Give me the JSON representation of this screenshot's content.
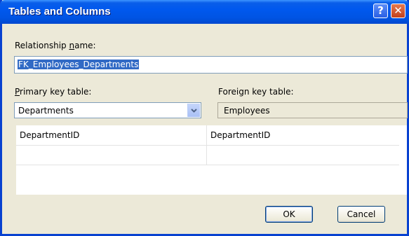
{
  "window": {
    "title": "Tables and Columns",
    "help_glyph": "?",
    "close_glyph": "✕"
  },
  "relationship": {
    "label_pre": "Relationship ",
    "label_mnemonic": "n",
    "label_post": "ame:",
    "value": "FK_Employees_Departments"
  },
  "primary": {
    "label_mnemonic": "P",
    "label_post": "rimary key table:",
    "selected": "Departments"
  },
  "foreign": {
    "label": "Foreign key table:",
    "value": "Employees"
  },
  "columns": {
    "rows": [
      {
        "primary": "DepartmentID",
        "foreign": "DepartmentID"
      },
      {
        "primary": "",
        "foreign": ""
      }
    ]
  },
  "buttons": {
    "ok": "OK",
    "cancel": "Cancel"
  }
}
